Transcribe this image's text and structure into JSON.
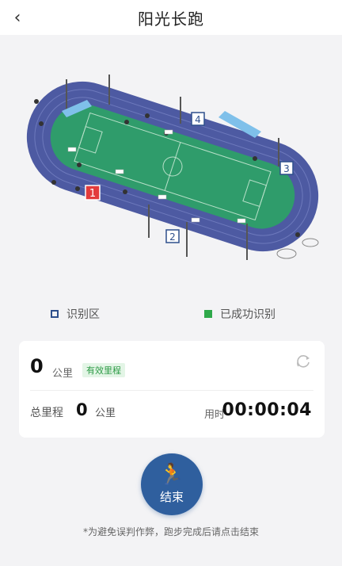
{
  "header": {
    "title": "阳光长跑",
    "back_icon": "chevron-left-icon"
  },
  "map": {
    "checkpoints": [
      "1",
      "2",
      "3",
      "4"
    ],
    "colors": {
      "track": "#4d5aa2",
      "field": "#2f9c6b",
      "checkpoint_active": "#e33b3b"
    }
  },
  "legend": {
    "zone_label": "识别区",
    "success_label": "已成功识别"
  },
  "stats": {
    "distance_value": "0",
    "distance_unit": "公里",
    "valid_badge": "有效里程",
    "total_label": "总里程",
    "total_value": "0",
    "total_unit": "公里",
    "time_label": "用时",
    "time_value": "00:00:04"
  },
  "actions": {
    "end_label": "结束",
    "end_icon": "runner-icon",
    "refresh_icon": "refresh-icon"
  },
  "footer": {
    "note": "*为避免误判作弊，跑步完成后请点击结束"
  }
}
